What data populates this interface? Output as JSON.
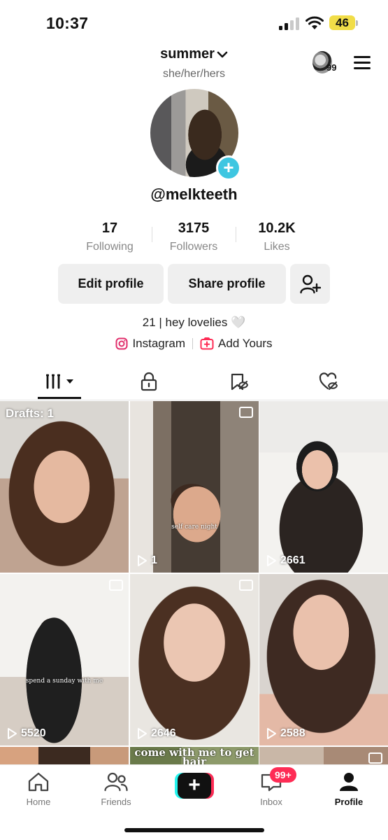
{
  "status_bar": {
    "time": "10:37",
    "battery_level": "46",
    "signal_bars_filled": 2,
    "signal_bars_total": 4
  },
  "header": {
    "username": "summer",
    "pronouns": "she/her/hers",
    "streak_count": "99"
  },
  "profile": {
    "handle": "@melkteeth",
    "bio": "21 | hey lovelies 🤍"
  },
  "stats": [
    {
      "value": "17",
      "label": "Following"
    },
    {
      "value": "3175",
      "label": "Followers"
    },
    {
      "value": "10.2K",
      "label": "Likes"
    }
  ],
  "buttons": {
    "edit_profile": "Edit profile",
    "share_profile": "Share profile"
  },
  "links": {
    "instagram": "Instagram",
    "add_yours": "Add Yours"
  },
  "grid": {
    "drafts_label": "Drafts: 1",
    "tiles": [
      {
        "count": "",
        "caption": ""
      },
      {
        "count": "1",
        "caption": "self care night"
      },
      {
        "count": "2661",
        "caption": ""
      },
      {
        "count": "5520",
        "caption": "spend a sunday with me"
      },
      {
        "count": "2646",
        "caption": ""
      },
      {
        "count": "2588",
        "caption": ""
      },
      {
        "count": "",
        "caption": "come with me to get hair"
      }
    ]
  },
  "bottom_nav": {
    "home": "Home",
    "friends": "Friends",
    "inbox": "Inbox",
    "inbox_badge": "99+",
    "profile": "Profile"
  },
  "colors": {
    "accent_cyan": "#25f4ee",
    "accent_red": "#fe2c55",
    "avatar_add": "#3ec6e1",
    "battery": "#f1dd48"
  }
}
